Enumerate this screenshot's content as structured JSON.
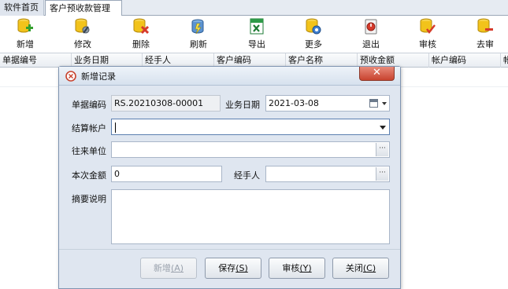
{
  "tabs": [
    {
      "label": "软件首页"
    },
    {
      "label": "客户预收款管理"
    }
  ],
  "toolbar": {
    "items": [
      {
        "label": "新增",
        "icon": "add-db-icon"
      },
      {
        "label": "修改",
        "icon": "edit-db-icon"
      },
      {
        "label": "删除",
        "icon": "delete-db-icon"
      },
      {
        "label": "刷新",
        "icon": "refresh-icon"
      },
      {
        "label": "导出",
        "icon": "excel-export-icon"
      },
      {
        "label": "更多",
        "icon": "more-gear-icon"
      },
      {
        "label": "退出",
        "icon": "exit-icon"
      },
      {
        "label": "审核",
        "icon": "approve-icon"
      },
      {
        "label": "去审",
        "icon": "unapprove-icon"
      }
    ]
  },
  "grid": {
    "columns": [
      "单据编号",
      "业务日期",
      "经手人",
      "客户编码",
      "客户名称",
      "预收金额",
      "帐户编码",
      "帐"
    ]
  },
  "dialog": {
    "title": "新增记录",
    "close_symbol": "✕",
    "fields": {
      "doc_no_label": "单据编码",
      "doc_no_value": "RS.20210308-00001",
      "date_label": "业务日期",
      "date_value": "2021-03-08",
      "account_label": "结算帐户",
      "account_value": "",
      "partner_label": "往来单位",
      "partner_value": "",
      "amount_label": "本次金额",
      "amount_value": "0",
      "handler_label": "经手人",
      "handler_value": "",
      "memo_label": "摘要说明",
      "memo_value": ""
    },
    "buttons": {
      "new_label": "新增",
      "new_key": "(A)",
      "save_label": "保存",
      "save_key": "(S)",
      "approve_label": "审核",
      "approve_key": "(Y)",
      "close_label": "关闭",
      "close_key": "(C)"
    },
    "ellipsis": "···"
  },
  "colors": {
    "accent": "#3f6fb0",
    "db_yellow": "#f2c31b",
    "add_green": "#34a02e",
    "delete_red": "#d63a2b",
    "close_red": "#c8432f"
  }
}
